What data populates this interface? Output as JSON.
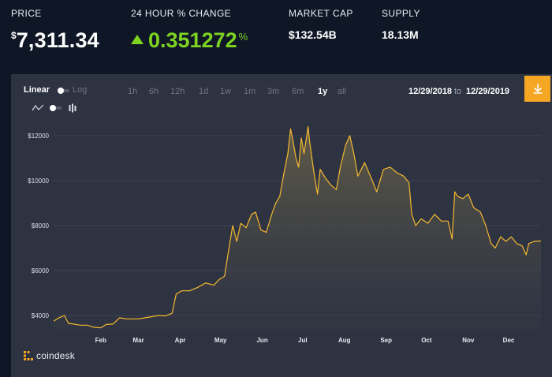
{
  "stats": {
    "price": {
      "label": "PRICE",
      "currency": "$",
      "value": "7,311.34"
    },
    "change": {
      "label": "24 HOUR % CHANGE",
      "value": "0.351272",
      "unit": "%"
    },
    "market_cap": {
      "label": "MARKET CAP",
      "value": "$132.54B"
    },
    "supply": {
      "label": "SUPPLY",
      "value": "18.13M"
    }
  },
  "controls": {
    "scale_linear": "Linear",
    "scale_log": "Log",
    "ranges": [
      "1h",
      "6h",
      "12h",
      "1d",
      "1w",
      "1m",
      "3m",
      "6m",
      "1y",
      "all"
    ],
    "active_range": "1y",
    "date_from": "12/29/2018",
    "date_to_label": "to",
    "date_to": "12/29/2019"
  },
  "brand": {
    "name": "coindesk"
  },
  "colors": {
    "line": "#f5b82e",
    "accent": "#f5a623",
    "positive": "#7ed321",
    "panel": "#2e3342",
    "background": "#0f1726"
  },
  "chart_data": {
    "type": "area",
    "x_unit": "date",
    "x_range": [
      "2019-01-01",
      "2019-12-29"
    ],
    "ylim": [
      3300,
      12700
    ],
    "y_ticks": [
      4000,
      6000,
      8000,
      10000,
      12000
    ],
    "y_tick_labels": [
      "$4000",
      "$6000",
      "$8000",
      "$10000",
      "$12000"
    ],
    "x_tick_labels": [
      "Feb",
      "Mar",
      "Apr",
      "May",
      "Jun",
      "Jul",
      "Aug",
      "Sep",
      "Oct",
      "Nov",
      "Dec"
    ],
    "grid": true,
    "series": [
      {
        "x": [
          "2019-01-01",
          "2019-01-05",
          "2019-01-09",
          "2019-01-12",
          "2019-01-16",
          "2019-01-21",
          "2019-01-26",
          "2019-01-31",
          "2019-02-05",
          "2019-02-09",
          "2019-02-14",
          "2019-02-19",
          "2019-02-24",
          "2019-02-28",
          "2019-03-05",
          "2019-03-10",
          "2019-03-15",
          "2019-03-20",
          "2019-03-25",
          "2019-03-30",
          "2019-04-02",
          "2019-04-06",
          "2019-04-12",
          "2019-04-18",
          "2019-04-24",
          "2019-04-30",
          "2019-05-04",
          "2019-05-08",
          "2019-05-11",
          "2019-05-14",
          "2019-05-17",
          "2019-05-20",
          "2019-05-24",
          "2019-05-28",
          "2019-05-31",
          "2019-06-04",
          "2019-06-08",
          "2019-06-12",
          "2019-06-15",
          "2019-06-18",
          "2019-06-21",
          "2019-06-24",
          "2019-06-26",
          "2019-06-28",
          "2019-06-30",
          "2019-07-02",
          "2019-07-04",
          "2019-07-06",
          "2019-07-09",
          "2019-07-10",
          "2019-07-13",
          "2019-07-16",
          "2019-07-18",
          "2019-07-22",
          "2019-07-26",
          "2019-07-30",
          "2019-08-02",
          "2019-08-06",
          "2019-08-09",
          "2019-08-12",
          "2019-08-15",
          "2019-08-20",
          "2019-08-25",
          "2019-08-29",
          "2019-09-03",
          "2019-09-08",
          "2019-09-13",
          "2019-09-18",
          "2019-09-22",
          "2019-09-24",
          "2019-09-27",
          "2019-10-01",
          "2019-10-06",
          "2019-10-11",
          "2019-10-16",
          "2019-10-21",
          "2019-10-24",
          "2019-10-26",
          "2019-10-28",
          "2019-11-01",
          "2019-11-05",
          "2019-11-09",
          "2019-11-14",
          "2019-11-18",
          "2019-11-22",
          "2019-11-25",
          "2019-11-29",
          "2019-12-03",
          "2019-12-07",
          "2019-12-11",
          "2019-12-15",
          "2019-12-18",
          "2019-12-20",
          "2019-12-24",
          "2019-12-29"
        ],
        "y": [
          3750,
          3900,
          4000,
          3650,
          3620,
          3570,
          3570,
          3480,
          3450,
          3600,
          3620,
          3900,
          3850,
          3850,
          3850,
          3900,
          3950,
          4000,
          3980,
          4100,
          4950,
          5100,
          5100,
          5250,
          5450,
          5350,
          5600,
          5750,
          6900,
          8000,
          7300,
          8100,
          7900,
          8500,
          8600,
          7800,
          7700,
          8500,
          9000,
          9300,
          10300,
          11200,
          12300,
          11700,
          11000,
          10600,
          11900,
          11200,
          12400,
          11800,
          10500,
          9400,
          10500,
          10100,
          9800,
          9600,
          10600,
          11600,
          12000,
          11200,
          10200,
          10800,
          10100,
          9500,
          10500,
          10600,
          10350,
          10200,
          9900,
          8500,
          8000,
          8300,
          8100,
          8500,
          8200,
          8200,
          7400,
          9500,
          9300,
          9200,
          9400,
          8800,
          8600,
          8000,
          7200,
          7000,
          7500,
          7300,
          7500,
          7200,
          7100,
          6700,
          7200,
          7300,
          7311
        ]
      }
    ]
  }
}
